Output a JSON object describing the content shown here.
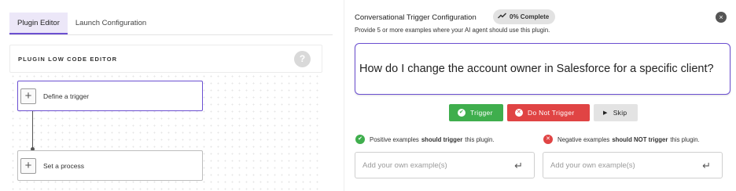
{
  "tabs": [
    {
      "label": "Plugin Editor",
      "active": true
    },
    {
      "label": "Launch Configuration",
      "active": false
    }
  ],
  "editor": {
    "title": "PLUGIN LOW CODE EDITOR",
    "help_glyph": "?",
    "nodes": [
      {
        "label": "Define a trigger",
        "plus": "+"
      },
      {
        "label": "Set a process",
        "plus": "+"
      }
    ]
  },
  "config": {
    "title": "Conversational Trigger Configuration",
    "progress": "0% Complete",
    "progress_icon": "trend-up-icon",
    "subtitle": "Provide 5 or more examples where your AI agent should use this plugin.",
    "close_glyph": "×",
    "example": "How do I change the account owner in Salesforce for a specific client?",
    "buttons": {
      "trigger": "Trigger",
      "not_trigger": "Do Not Trigger",
      "skip": "Skip"
    },
    "positive": {
      "pre": "Positive examples",
      "bold": "should trigger",
      "post": "this plugin.",
      "placeholder": "Add your own example(s)"
    },
    "negative": {
      "pre": "Negative examples",
      "bold": "should NOT trigger",
      "post": "this plugin.",
      "placeholder": "Add your own example(s)"
    }
  },
  "colors": {
    "accent": "#6b4fd1",
    "trigger_green": "#3fae4d",
    "not_trigger_red": "#e04444"
  }
}
